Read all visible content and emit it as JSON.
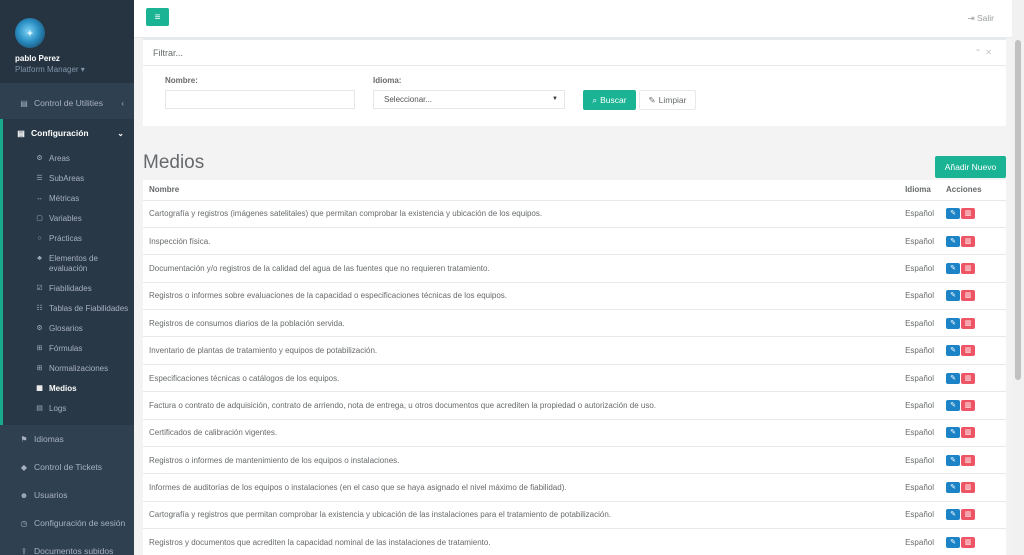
{
  "user": {
    "name": "pablo Perez",
    "role": "Platform Manager ▾"
  },
  "nav": {
    "control_utilities": "Control de Utilities",
    "configuracion": "Configuración",
    "sub": [
      {
        "label": "Areas",
        "icon": "⚙"
      },
      {
        "label": "SubAreas",
        "icon": "☰"
      },
      {
        "label": "Métricas",
        "icon": "↔"
      },
      {
        "label": "Variables",
        "icon": "▢"
      },
      {
        "label": "Prácticas",
        "icon": "○"
      },
      {
        "label": "Elementos de evaluación",
        "icon": "♣"
      },
      {
        "label": "Fiabilidades",
        "icon": "☑"
      },
      {
        "label": "Tablas de Fiabilidades",
        "icon": "☷"
      },
      {
        "label": "Glosarios",
        "icon": "⚙"
      },
      {
        "label": "Fórmulas",
        "icon": "⊞"
      },
      {
        "label": "Normalizaciones",
        "icon": "⊞"
      },
      {
        "label": "Medios",
        "icon": "▦"
      },
      {
        "label": "Logs",
        "icon": "▤"
      }
    ],
    "idiomas": "Idiomas",
    "tickets": "Control de Tickets",
    "usuarios": "Usuarios",
    "sesion": "Configuración de sesión",
    "documentos": "Documentos subidos"
  },
  "topbar": {
    "logout": "Salir"
  },
  "filter": {
    "title": "Filtrar...",
    "nombre_label": "Nombre:",
    "nombre_value": "",
    "idioma_label": "Idioma:",
    "idioma_selected": "Seleccionar...",
    "buscar": "Buscar",
    "limpiar": "Limpiar"
  },
  "page": {
    "title": "Medios",
    "new_button": "Añadir Nuevo"
  },
  "table": {
    "headers": [
      "Nombre",
      "Idioma",
      "Acciones"
    ],
    "rows": [
      {
        "nombre": "Cartografía y registros (imágenes satelitales) que permitan comprobar la existencia y ubicación de los equipos.",
        "idioma": "Español"
      },
      {
        "nombre": "Inspección física.",
        "idioma": "Español"
      },
      {
        "nombre": "Documentación y/o registros de la calidad del agua de las fuentes que no requieren tratamiento.",
        "idioma": "Español"
      },
      {
        "nombre": "Registros o informes sobre evaluaciones de la capacidad o especificaciones técnicas de los equipos.",
        "idioma": "Español"
      },
      {
        "nombre": "Registros de consumos diarios de la población servida.",
        "idioma": "Español"
      },
      {
        "nombre": "Inventario de plantas de tratamiento y equipos de potabilización.",
        "idioma": "Español"
      },
      {
        "nombre": "Especificaciones técnicas o catálogos de los equipos.",
        "idioma": "Español"
      },
      {
        "nombre": "Factura o contrato de adquisición, contrato de arriendo, nota de entrega, u otros documentos que acrediten la propiedad o autorización de uso.",
        "idioma": "Español"
      },
      {
        "nombre": "Certificados de calibración vigentes.",
        "idioma": "Español"
      },
      {
        "nombre": "Registros o informes de mantenimiento de los equipos o instalaciones.",
        "idioma": "Español"
      },
      {
        "nombre": "Informes de auditorías de los equipos o instalaciones (en el caso que se haya asignado el nivel máximo de fiabilidad).",
        "idioma": "Español"
      },
      {
        "nombre": "Cartografía y registros que permitan comprobar la existencia y ubicación de las instalaciones para el tratamiento de potabilización.",
        "idioma": "Español"
      },
      {
        "nombre": "Registros y documentos que acrediten la capacidad nominal de las instalaciones de tratamiento.",
        "idioma": "Español"
      }
    ]
  },
  "colors": {
    "primary": "#1ab394",
    "sidebar": "#2f4050",
    "edit": "#1c84c6",
    "delete": "#ed5565"
  }
}
